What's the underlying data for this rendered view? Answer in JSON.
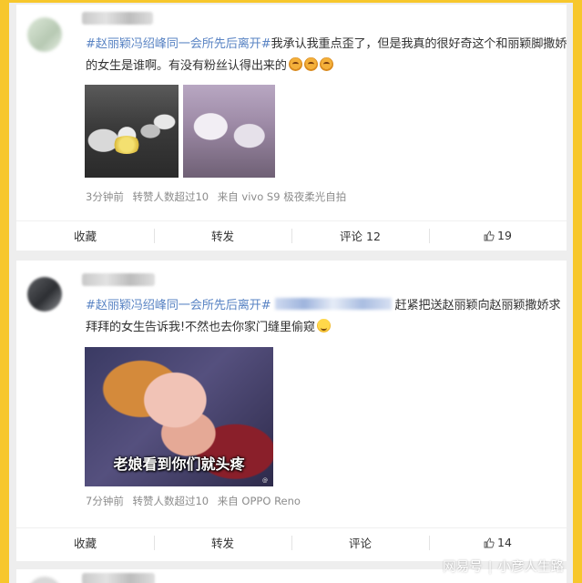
{
  "posts": [
    {
      "topic": "#赵丽颖冯绍峰同一会所先后离开#",
      "text": "我承认我重点歪了，但是我真的很好奇这个和丽颖脚撒娇的女生是谁啊。有没有粉丝认得出来的",
      "emoticon_count": 3,
      "images": [
        "photo-1",
        "photo-2"
      ],
      "time": "3分钟前",
      "reposts": "转赞人数超过10",
      "source": "来自 vivo S9 极夜柔光自拍",
      "actions": {
        "favorite": "收藏",
        "repost": "转发",
        "comment": "评论 12",
        "likes": "19"
      }
    },
    {
      "topic": "#赵丽颖冯绍峰同一会所先后离开#",
      "text_after_mention": "赶紧把送赵丽颖向赵丽颖撒娇求拜拜的女生告诉我!不然也去你家门缝里偷窥",
      "meme_caption": "老娘看到你们就头疼",
      "time": "7分钟前",
      "reposts": "转赞人数超过10",
      "source": "来自 OPPO Reno",
      "actions": {
        "favorite": "收藏",
        "repost": "转发",
        "comment": "评论",
        "likes": "14"
      }
    }
  ],
  "watermark": {
    "brand": "网易号",
    "author": "小彦人生路"
  },
  "colors": {
    "frame": "#f7c72c",
    "topic": "#5a84c4",
    "meta": "#8c8c8c",
    "background": "#eeeeee"
  },
  "icons": {
    "like": "thumbs-up-icon",
    "emoticon": "weibo-emoticon-icon",
    "avatar": "blurred-avatar"
  }
}
